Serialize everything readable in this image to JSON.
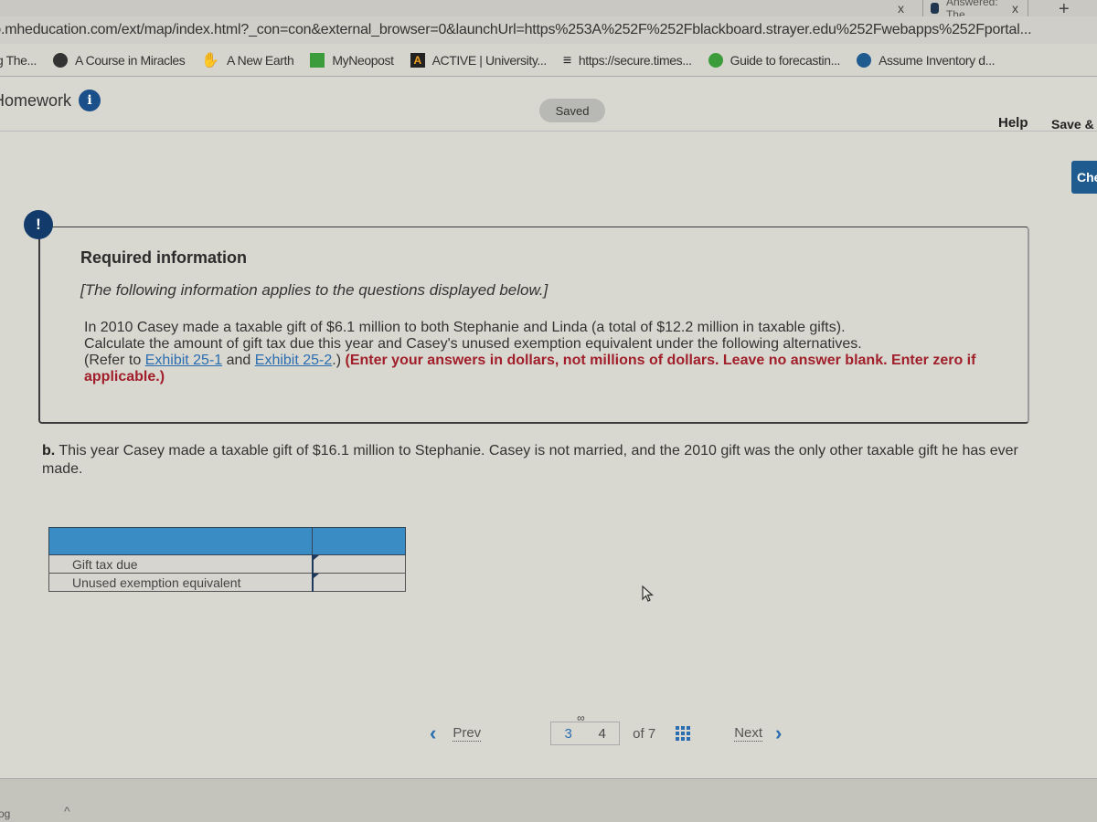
{
  "browser": {
    "tabs": [
      {
        "label": "",
        "close": "x"
      },
      {
        "label": "Answered: The",
        "close": "x"
      }
    ],
    "new_tab": "+",
    "url": "to.mheducation.com/ext/map/index.html?_con=con&external_browser=0&launchUrl=https%253A%252F%252Fblackboard.strayer.edu%252Fwebapps%252Fportal...",
    "bookmarks": [
      {
        "label": "g The...",
        "icon": "none"
      },
      {
        "label": "A Course in Miracles",
        "icon": "globe-icon"
      },
      {
        "label": "A New Earth",
        "icon": "hand-icon"
      },
      {
        "label": "MyNeopost",
        "icon": "neopost-icon"
      },
      {
        "label": "ACTIVE | University...",
        "icon": "active-icon"
      },
      {
        "label": "https://secure.times...",
        "icon": "times-icon"
      },
      {
        "label": "Guide to forecastin...",
        "icon": "guide-icon"
      },
      {
        "label": "Assume Inventory d...",
        "icon": "assume-icon"
      }
    ]
  },
  "header": {
    "title": "Homework",
    "info_icon": "i",
    "saved_label": "Saved",
    "help_label": "Help",
    "save_exit_label": "Save & E",
    "check_label": "Che"
  },
  "required_info": {
    "alert_icon": "!",
    "title": "Required information",
    "note": "[The following information applies to the questions displayed below.]",
    "body_line1": "In 2010 Casey made a taxable gift of $6.1 million to both Stephanie and Linda (a total of $12.2 million in taxable gifts).",
    "body_line2": "Calculate the amount of gift tax due this year and Casey's unused exemption equivalent under the following alternatives.",
    "refer_prefix": "(Refer to ",
    "exhibit1": "Exhibit 25-1",
    "and_text": " and ",
    "exhibit2": "Exhibit 25-2",
    "refer_suffix": ".) ",
    "instructions": "(Enter your answers in dollars, not millions of dollars. Leave no answer blank. Enter zero if applicable.)"
  },
  "question": {
    "label": "b.",
    "text": " This year Casey made a taxable gift of $16.1 million to Stephanie. Casey is not married, and the 2010 gift was the only other taxable gift he has ever made."
  },
  "answer_table": {
    "rows": [
      {
        "label": "Gift tax due",
        "value": ""
      },
      {
        "label": "Unused exemption equivalent",
        "value": ""
      }
    ]
  },
  "pager": {
    "prev_label": "Prev",
    "page_a": "3",
    "page_b": "4",
    "of_label": "of 7",
    "next_label": "Next"
  },
  "footer": {
    "left_text": "og",
    "caret": "^"
  }
}
